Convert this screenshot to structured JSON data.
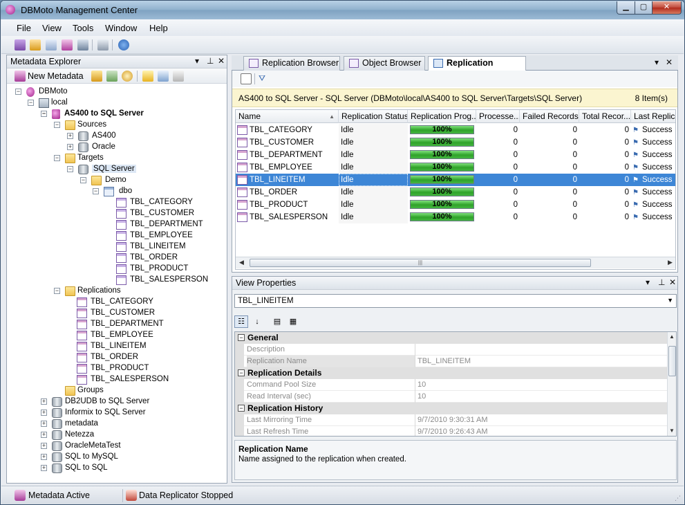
{
  "window": {
    "title": "DBMoto Management Center",
    "min": "▁",
    "max": "▢",
    "close": "✕"
  },
  "menu": [
    "File",
    "View",
    "Tools",
    "Window",
    "Help"
  ],
  "explorer": {
    "title": "Metadata Explorer",
    "new_metadata": "New Metadata",
    "tree": {
      "root": "DBMoto",
      "local": "local",
      "connection": "AS400 to SQL Server",
      "sources": "Sources",
      "source_items": [
        "AS400",
        "Oracle"
      ],
      "targets": "Targets",
      "target_server": "SQL Server",
      "demo": "Demo",
      "dbo": "dbo",
      "tables": [
        "TBL_CATEGORY",
        "TBL_CUSTOMER",
        "TBL_DEPARTMENT",
        "TBL_EMPLOYEE",
        "TBL_LINEITEM",
        "TBL_ORDER",
        "TBL_PRODUCT",
        "TBL_SALESPERSON"
      ],
      "replications": "Replications",
      "replication_items": [
        "TBL_CATEGORY",
        "TBL_CUSTOMER",
        "TBL_DEPARTMENT",
        "TBL_EMPLOYEE",
        "TBL_LINEITEM",
        "TBL_ORDER",
        "TBL_PRODUCT",
        "TBL_SALESPERSON"
      ],
      "groups": "Groups",
      "other_connections": [
        "DB2UDB to SQL Server",
        "Informix to SQL Server",
        "metadata",
        "Netezza",
        "OracleMetaTest",
        "SQL to MySQL",
        "SQL to SQL"
      ]
    }
  },
  "tabs": [
    "Replication Browser",
    "Object Browser",
    "Replication Monitor"
  ],
  "monitor": {
    "path": "AS400 to SQL Server - SQL Server (DBMoto\\local\\AS400 to SQL Server\\Targets\\SQL Server)",
    "count": "8 Item(s)",
    "columns": [
      "Name",
      "Replication Status",
      "Replication Prog...",
      "Processe...",
      "Failed Records",
      "Total Recor...",
      "Last Replica"
    ],
    "selected_index": 4,
    "rows": [
      {
        "name": "TBL_CATEGORY",
        "status": "Idle",
        "progress": "100%",
        "processed": "0",
        "failed": "0",
        "total": "0",
        "last": "Success"
      },
      {
        "name": "TBL_CUSTOMER",
        "status": "Idle",
        "progress": "100%",
        "processed": "0",
        "failed": "0",
        "total": "0",
        "last": "Success"
      },
      {
        "name": "TBL_DEPARTMENT",
        "status": "Idle",
        "progress": "100%",
        "processed": "0",
        "failed": "0",
        "total": "0",
        "last": "Success"
      },
      {
        "name": "TBL_EMPLOYEE",
        "status": "Idle",
        "progress": "100%",
        "processed": "0",
        "failed": "0",
        "total": "0",
        "last": "Success"
      },
      {
        "name": "TBL_LINEITEM",
        "status": "Idle",
        "progress": "100%",
        "processed": "0",
        "failed": "0",
        "total": "0",
        "last": "Success"
      },
      {
        "name": "TBL_ORDER",
        "status": "Idle",
        "progress": "100%",
        "processed": "0",
        "failed": "0",
        "total": "0",
        "last": "Success"
      },
      {
        "name": "TBL_PRODUCT",
        "status": "Idle",
        "progress": "100%",
        "processed": "0",
        "failed": "0",
        "total": "0",
        "last": "Success"
      },
      {
        "name": "TBL_SALESPERSON",
        "status": "Idle",
        "progress": "100%",
        "processed": "0",
        "failed": "0",
        "total": "0",
        "last": "Success"
      }
    ]
  },
  "properties": {
    "title": "View Properties",
    "selected": "TBL_LINEITEM",
    "sections": [
      {
        "name": "General",
        "rows": [
          {
            "key": "Description",
            "value": ""
          },
          {
            "key": "Replication Name",
            "value": "TBL_LINEITEM"
          }
        ]
      },
      {
        "name": "Replication Details",
        "rows": [
          {
            "key": "Command Pool Size",
            "value": "10"
          },
          {
            "key": "Read Interval (sec)",
            "value": "10"
          }
        ]
      },
      {
        "name": "Replication History",
        "rows": [
          {
            "key": "Last Mirroring Time",
            "value": "9/7/2010 9:30:31 AM"
          },
          {
            "key": "Last Refresh Time",
            "value": "9/7/2010 9:26:43 AM"
          }
        ]
      }
    ],
    "desc_title": "Replication Name",
    "desc_text": "Name assigned to the replication when created."
  },
  "statusbar": {
    "metadata": "Metadata Active",
    "replicator": "Data Replicator Stopped"
  }
}
